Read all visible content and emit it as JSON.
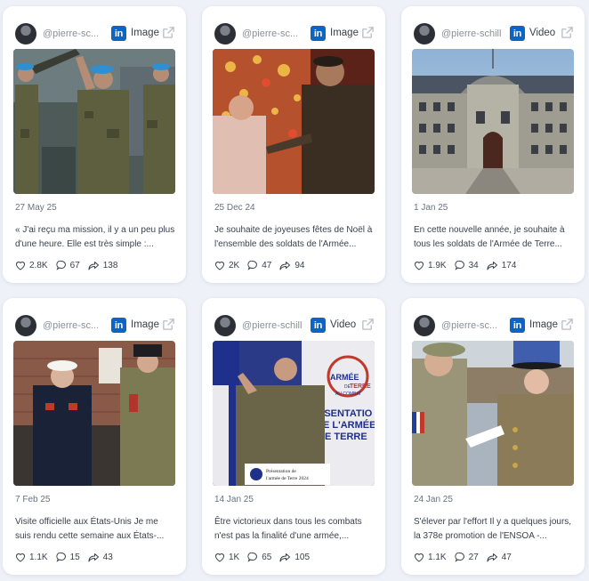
{
  "posts": [
    {
      "handle": "@pierre-sc...",
      "network": "in",
      "type": "Image",
      "date": "27 May 25",
      "text": "« J'ai reçu ma mission, il y a un peu plus d'une heure. Elle est très simple :...",
      "likes": "2.8K",
      "comments": "67",
      "shares": "138"
    },
    {
      "handle": "@pierre-sc...",
      "network": "in",
      "type": "Image",
      "date": "25 Dec 24",
      "text": "Je souhaite de joyeuses fêtes de Noël à l'ensemble des soldats de l'Armée...",
      "likes": "2K",
      "comments": "47",
      "shares": "94"
    },
    {
      "handle": "@pierre-schill",
      "network": "in",
      "type": "Video",
      "date": "1 Jan 25",
      "text": "En cette nouvelle année, je souhaite à tous les soldats de l'Armée de Terre...",
      "likes": "1.9K",
      "comments": "34",
      "shares": "174"
    },
    {
      "handle": "@pierre-sc...",
      "network": "in",
      "type": "Image",
      "date": "7 Feb 25",
      "text": "Visite officielle aux États-Unis Je me suis rendu cette semaine aux États-...",
      "likes": "1.1K",
      "comments": "15",
      "shares": "43"
    },
    {
      "handle": "@pierre-schill",
      "network": "in",
      "type": "Video",
      "date": "14 Jan 25",
      "text": "Être victorieux dans tous les combats n'est pas la finalité d'une armée,...",
      "likes": "1K",
      "comments": "65",
      "shares": "105",
      "overlay": {
        "logo_line1": "ARMÉE",
        "logo_line2": "DE",
        "logo_line3": "TERRE",
        "logo_line4": "AU COMBAT",
        "banner_lines": [
          "ÉSENTATIO",
          "E L'ARMÉE",
          "E TERRE"
        ],
        "caption_line1": "Présentation de",
        "caption_line2": "l'armée de Terre 2024"
      }
    },
    {
      "handle": "@pierre-sc...",
      "network": "in",
      "type": "Image",
      "date": "24 Jan 25",
      "text": "S'élever par l'effort Il y a quelques jours, la 378e promotion de l'ENSOA -...",
      "likes": "1.1K",
      "comments": "27",
      "shares": "47"
    }
  ],
  "colors": {
    "linkedin": "#0a66c2",
    "background": "#eef1f8",
    "card": "#ffffff"
  },
  "icons": {
    "like": "heart-icon",
    "comment": "comment-bubble-icon",
    "share": "share-arrow-icon",
    "external": "external-link-icon"
  }
}
